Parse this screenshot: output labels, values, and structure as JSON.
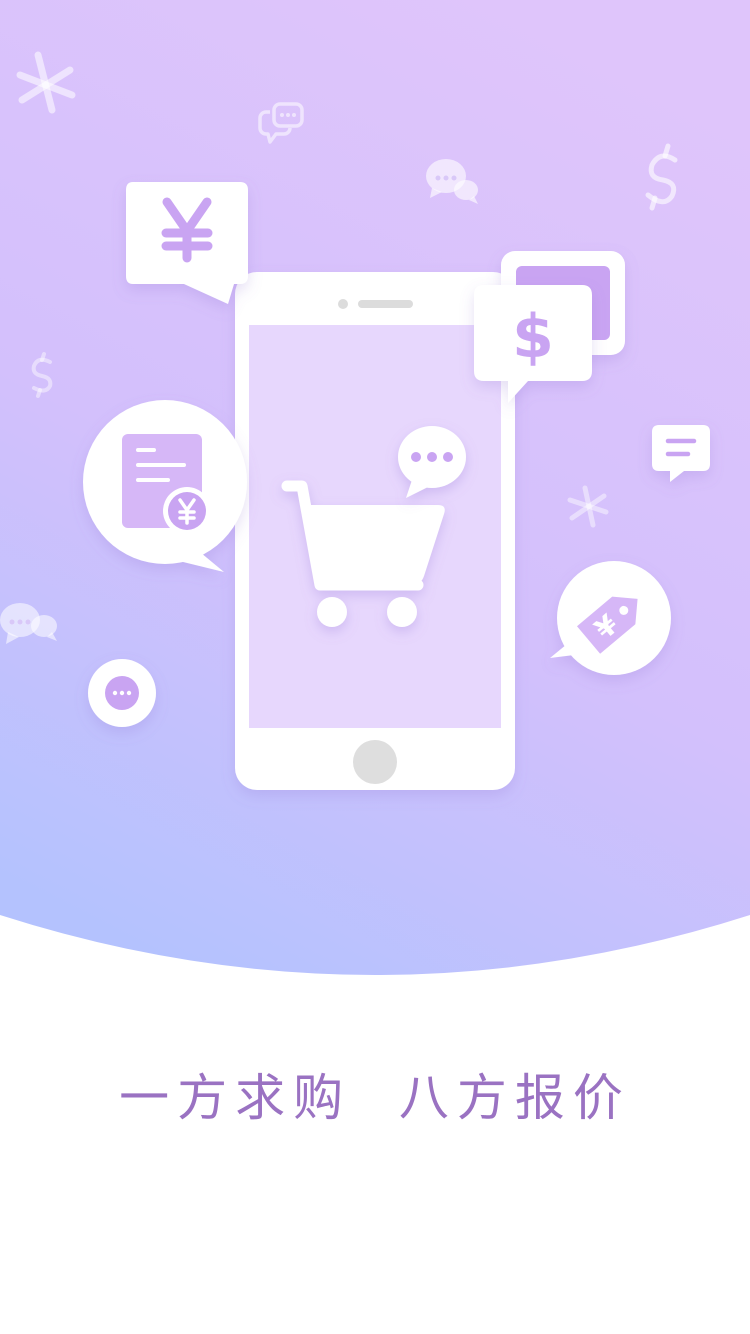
{
  "screen": {
    "tagline": "一方求购  八方报价"
  },
  "illustration": {
    "price_tag_symbol": "¥",
    "currency_symbol": "$",
    "icons": [
      "shopping-cart-icon",
      "yuan-speech-bubble-icon",
      "dollar-speech-bubble-icon",
      "invoice-bubble-icon",
      "price-tag-bubble-icon",
      "chat-bubble-icon",
      "message-bubble-icon",
      "ellipsis-bubble-icon"
    ]
  },
  "colors": {
    "gradient_top": "#dfc5fb",
    "gradient_bottom": "#b7c3fe",
    "accent": "#c9a4f2",
    "phone_screen": "#e7d7fd",
    "tagline": "#9a72c2"
  }
}
